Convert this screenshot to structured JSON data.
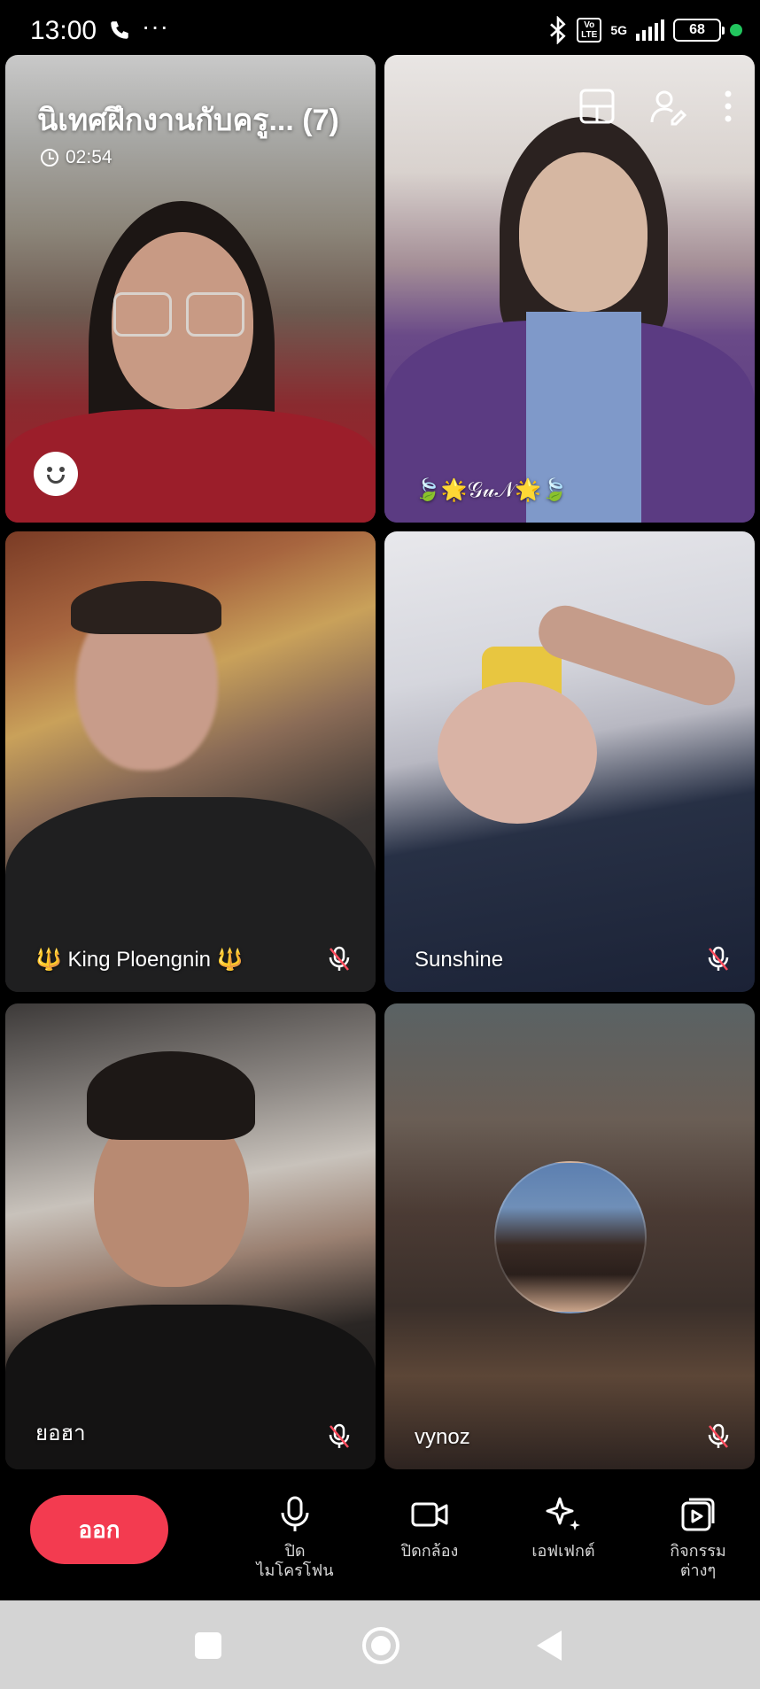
{
  "status_bar": {
    "time": "13:00",
    "dots": "···",
    "volte": "Vo\nLTE",
    "network": "5G",
    "battery": "68"
  },
  "call": {
    "title": "นิเทศฝึกงานกับครู... (7)",
    "timer": "02:54"
  },
  "participants": [
    {
      "name": "",
      "muted": false
    },
    {
      "name": "🍃🌟𝒢𝓊𝒩🌟🍃",
      "muted": false
    },
    {
      "name": "🔱 King Ploengnin 🔱",
      "muted": true
    },
    {
      "name": "Sunshine",
      "muted": true
    },
    {
      "name": "ยอฮา",
      "muted": true
    },
    {
      "name": "vynoz",
      "muted": true
    }
  ],
  "controls": {
    "leave": "ออก",
    "mic": "ปิด\nไมโครโฟน",
    "camera": "ปิดกล้อง",
    "effects": "เอฟเฟกต์",
    "activities": "กิจกรรม\nต่างๆ"
  },
  "icons": {
    "layout": "layout-icon",
    "add_person": "add-person-icon",
    "more": "more-vertical-icon",
    "emoji": "emoji-icon",
    "mic": "microphone-icon",
    "camera": "video-camera-icon",
    "effects": "sparkle-icon",
    "activities": "activities-icon"
  },
  "colors": {
    "leave_button": "#f33b50",
    "online_dot": "#22c55e"
  }
}
